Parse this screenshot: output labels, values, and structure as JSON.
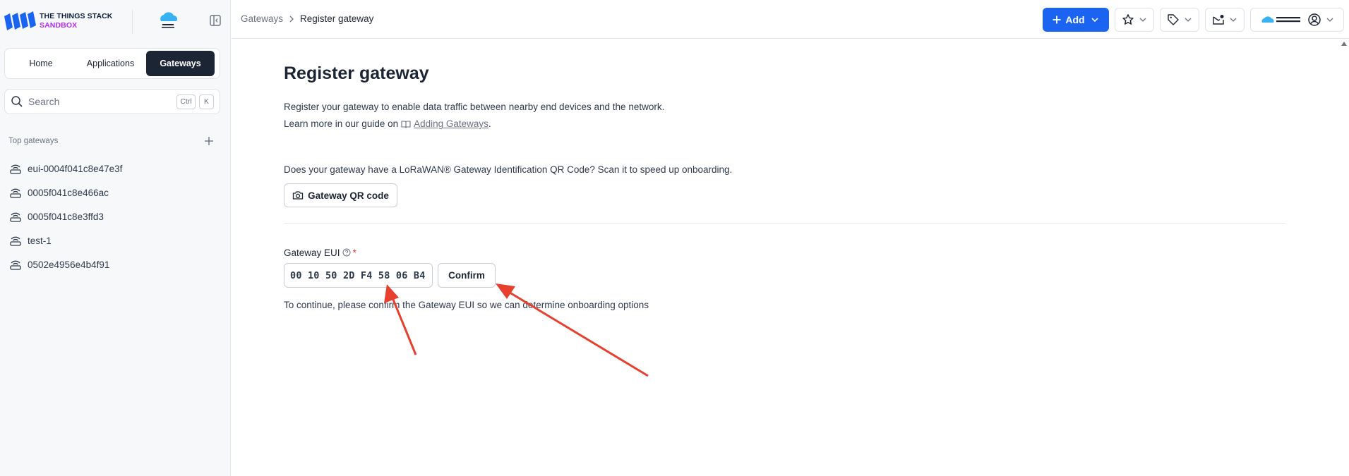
{
  "app": {
    "brand_line1": "THE THINGS STACK",
    "brand_line2": "SANDBOX",
    "brand_colors": {
      "navy": "#0a1d3b",
      "purple": "#b52ef0",
      "blue": "#1b64f2"
    }
  },
  "sidebar": {
    "tabs": [
      {
        "label": "Home",
        "active": false
      },
      {
        "label": "Applications",
        "active": false
      },
      {
        "label": "Gateways",
        "active": true
      }
    ],
    "search": {
      "placeholder": "Search",
      "shortcut_1": "Ctrl",
      "shortcut_2": "K"
    },
    "section_title": "Top gateways",
    "gateways": [
      {
        "name": "eui-0004f041c8e47e3f"
      },
      {
        "name": "0005f041c8e466ac"
      },
      {
        "name": "0005f041c8e3ffd3"
      },
      {
        "name": "test-1"
      },
      {
        "name": "0502e4956e4b4f91"
      }
    ]
  },
  "header": {
    "breadcrumb_parent": "Gateways",
    "breadcrumb_current": "Register gateway",
    "add_label": "Add",
    "icons": [
      "star-icon",
      "tag-icon",
      "notification-icon",
      "user-icon"
    ]
  },
  "main": {
    "title": "Register gateway",
    "desc_line1": "Register your gateway to enable data traffic between nearby end devices and the network.",
    "desc_line2_prefix": "Learn more in our guide on",
    "desc_link": "Adding Gateways",
    "desc_line2_suffix": ".",
    "qr_question": "Does your gateway have a LoRaWAN® Gateway Identification QR Code? Scan it to speed up onboarding.",
    "qr_button": "Gateway QR code",
    "eui_label": "Gateway EUI",
    "eui_required": "*",
    "eui_value": "00 10 50 2D F4 58 06 B4",
    "confirm_label": "Confirm",
    "hint": "To continue, please confirm the Gateway EUI so we can determine onboarding options"
  },
  "annotations": {
    "arrow_color": "#e8402f"
  }
}
